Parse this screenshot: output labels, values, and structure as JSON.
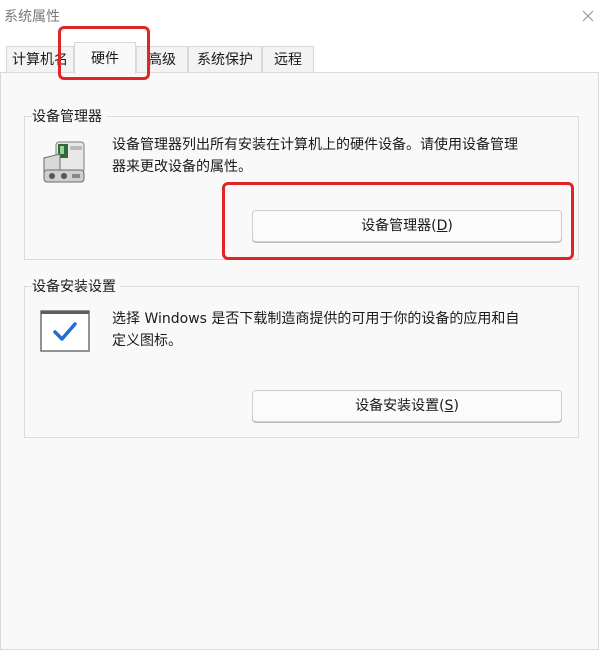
{
  "window": {
    "title": "系统属性"
  },
  "tabs": [
    {
      "label": "计算机名"
    },
    {
      "label": "硬件",
      "selected": true
    },
    {
      "label": "高级"
    },
    {
      "label": "系统保护"
    },
    {
      "label": "远程"
    }
  ],
  "device_manager": {
    "group_title": "设备管理器",
    "description": "设备管理器列出所有安装在计算机上的硬件设备。请使用设备管理器来更改设备的属性。",
    "description_line1": "设备管理器列出所有安装在计算机上的硬件设备。请使用设备管理",
    "description_line2": "器来更改设备的属性。",
    "button_label": "设备管理器(",
    "button_mnemonic": "D",
    "button_suffix": ")"
  },
  "device_install": {
    "group_title": "设备安装设置",
    "description_line1": "选择 Windows 是否下载制造商提供的可用于你的设备的应用和自",
    "description_line2": "定义图标。",
    "button_label": "设备安装设置(",
    "button_mnemonic": "S",
    "button_suffix": ")"
  },
  "colors": {
    "highlight": "#e02525",
    "check": "#1f6fd1"
  }
}
